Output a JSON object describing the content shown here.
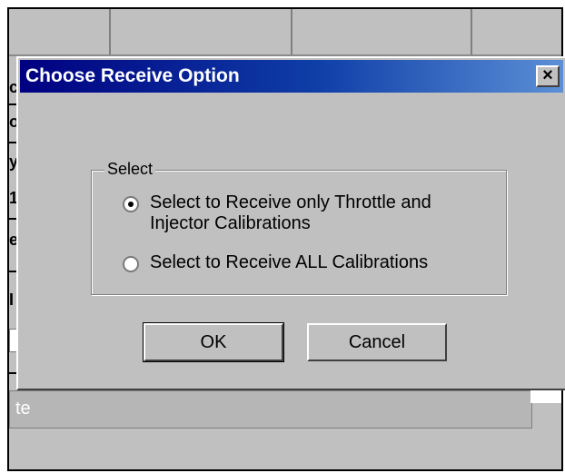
{
  "dialog": {
    "title": "Choose Receive Option",
    "close_glyph": "×",
    "group_label": "Select",
    "options": [
      {
        "label": "Select to Receive only Throttle and Injector Calibrations",
        "selected": true
      },
      {
        "label": "Select to Receive ALL Calibrations",
        "selected": false
      }
    ],
    "ok_label": "OK",
    "cancel_label": "Cancel"
  },
  "background": {
    "left_sliver": [
      "c",
      "o",
      "y",
      "1",
      "e",
      "I"
    ],
    "status_text": "te"
  },
  "colors": {
    "title_bar_start": "#000080",
    "title_bar_end": "#5b8fd6",
    "window_face": "#c0c0c0"
  }
}
